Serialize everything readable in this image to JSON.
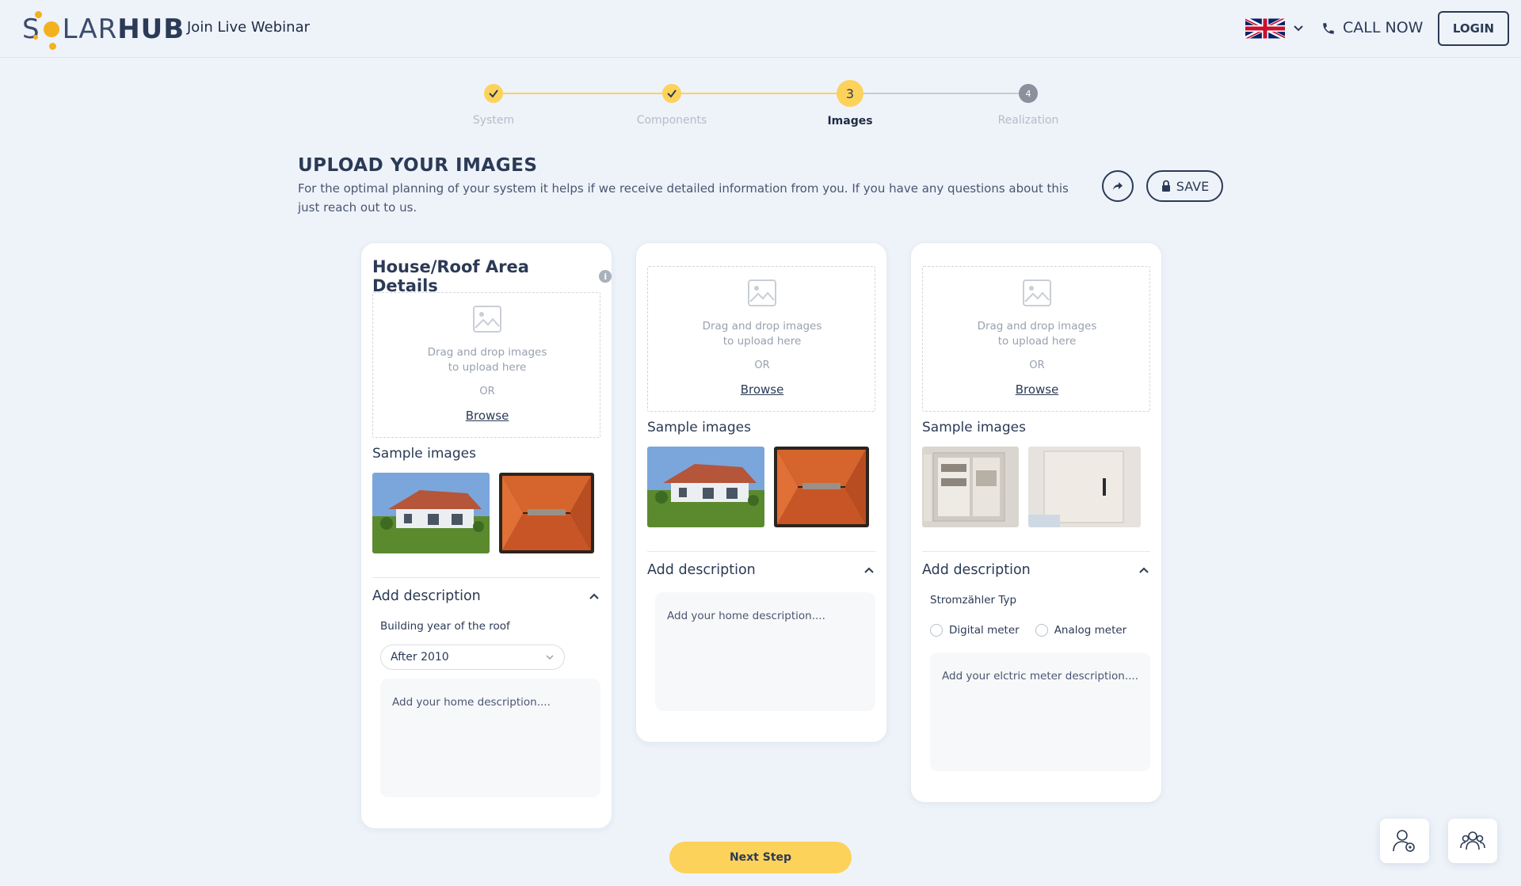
{
  "header": {
    "logo_solar": "S",
    "logo_rest": "LAR",
    "logo_hub": "HUB",
    "webinar": "Join Live Webinar",
    "call_now": "CALL NOW",
    "login": "LOGIN"
  },
  "stepper": {
    "steps": [
      {
        "label": "System",
        "state": "done"
      },
      {
        "label": "Components",
        "state": "done"
      },
      {
        "label": "Images",
        "state": "active",
        "number": "3"
      },
      {
        "label": "Realization",
        "state": "pending",
        "number": "4"
      }
    ]
  },
  "page": {
    "title": "UPLOAD YOUR IMAGES",
    "subtitle": "For the optimal planning of your system it helps if we receive detailed information from you. If you have any questions about this just reach out to us.",
    "save": "SAVE"
  },
  "cards": [
    {
      "title": "House/Roof Area Details",
      "drop_text": "Drag and drop images to upload here",
      "or": "OR",
      "browse": "Browse",
      "sample_title": "Sample images",
      "desc_title": "Add description",
      "field_label": "Building year of the roof",
      "select_value": "After 2010",
      "textarea_placeholder": "Add your home description...."
    },
    {
      "drop_text": "Drag and drop images to upload here",
      "or": "OR",
      "browse": "Browse",
      "sample_title": "Sample images",
      "desc_title": "Add description",
      "textarea_placeholder": "Add your home description...."
    },
    {
      "drop_text": "Drag and drop images to upload here",
      "or": "OR",
      "browse": "Browse",
      "sample_title": "Sample images",
      "desc_title": "Add description",
      "field_label": "Stromzähler Typ",
      "radio_options": [
        "Digital meter",
        "Analog meter"
      ],
      "textarea_placeholder": "Add your elctric meter description...."
    }
  ],
  "next_step": "Next Step",
  "colors": {
    "accent": "#fdd25a",
    "step_done": "#fdd25a",
    "navy": "#2b3a55",
    "background": "#eef3fa"
  }
}
